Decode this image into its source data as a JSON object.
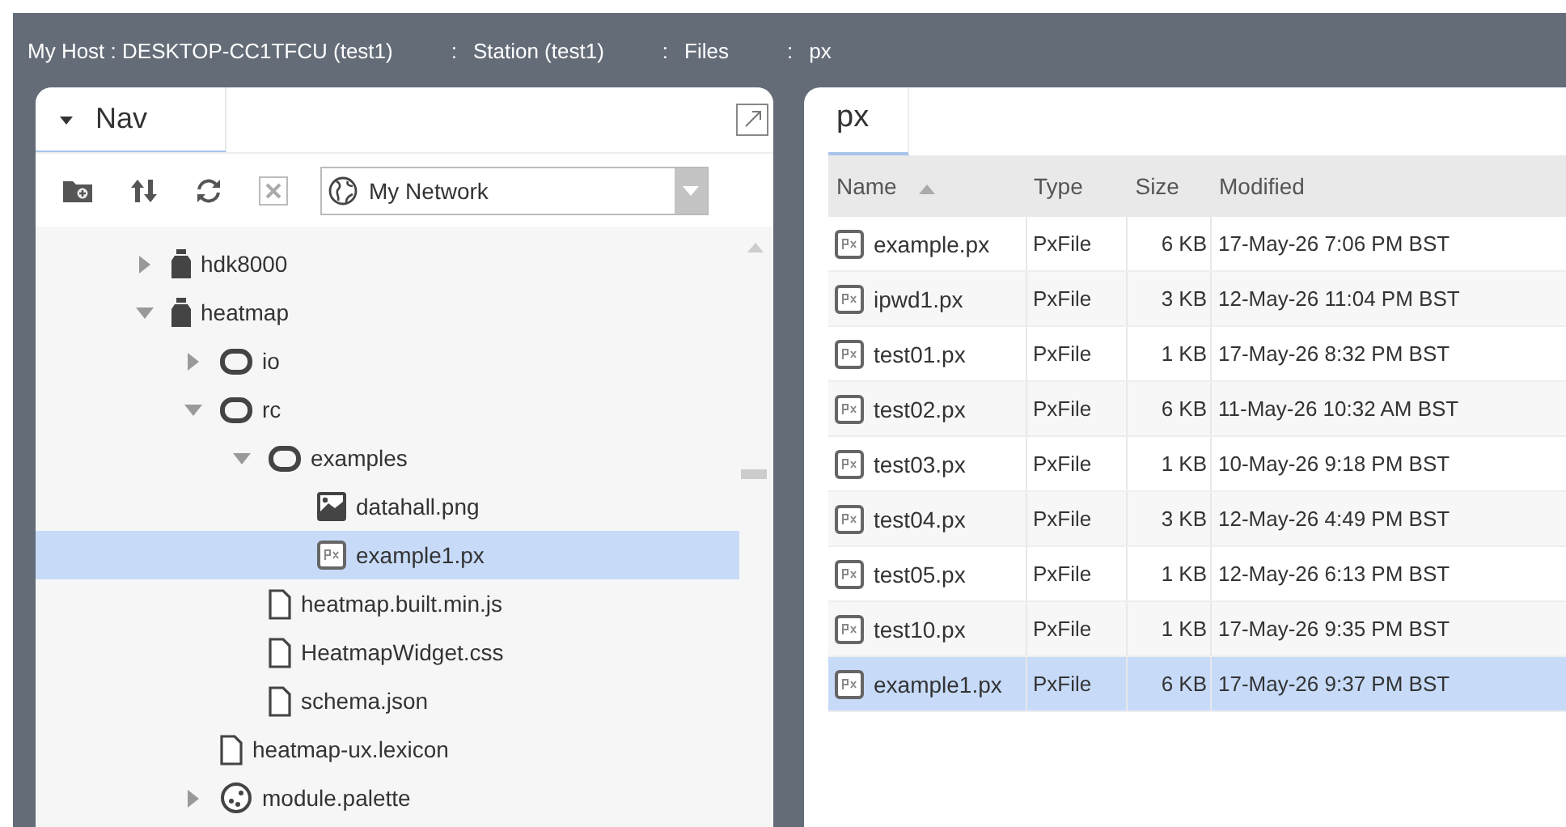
{
  "breadcrumb": {
    "separator": ":",
    "items": [
      "My Host : DESKTOP-CC1TFCU (test1)",
      "Station (test1)",
      "Files",
      "px"
    ]
  },
  "nav": {
    "tab": "Nav",
    "network": "My Network",
    "tree": [
      {
        "name": "hdk8000",
        "kind": "module",
        "expanded": false,
        "selected": false
      },
      {
        "name": "heatmap",
        "kind": "module",
        "expanded": true,
        "selected": false,
        "children": [
          {
            "name": "io",
            "kind": "folder",
            "expanded": false,
            "selected": false
          },
          {
            "name": "rc",
            "kind": "folder",
            "expanded": true,
            "selected": false,
            "children": [
              {
                "name": "examples",
                "kind": "folder",
                "expanded": true,
                "selected": false,
                "children": [
                  {
                    "name": "datahall.png",
                    "kind": "image",
                    "selected": false
                  },
                  {
                    "name": "example1.px",
                    "kind": "px",
                    "selected": true
                  }
                ]
              },
              {
                "name": "heatmap.built.min.js",
                "kind": "file",
                "selected": false
              },
              {
                "name": "HeatmapWidget.css",
                "kind": "file",
                "selected": false
              },
              {
                "name": "schema.json",
                "kind": "file",
                "selected": false
              }
            ]
          },
          {
            "name": "heatmap-ux.lexicon",
            "kind": "file",
            "selected": false
          },
          {
            "name": "module.palette",
            "kind": "palette",
            "expanded": false,
            "selected": false
          }
        ]
      }
    ]
  },
  "files": {
    "tab": "px",
    "columns": [
      "Name",
      "Type",
      "Size",
      "Modified"
    ],
    "rows": [
      {
        "name": "example.px",
        "type": "PxFile",
        "size": "6 KB",
        "modified": "17-May-26 7:06 PM BST",
        "selected": false
      },
      {
        "name": "ipwd1.px",
        "type": "PxFile",
        "size": "3 KB",
        "modified": "12-May-26 11:04 PM BST",
        "selected": false
      },
      {
        "name": "test01.px",
        "type": "PxFile",
        "size": "1 KB",
        "modified": "17-May-26 8:32 PM BST",
        "selected": false
      },
      {
        "name": "test02.px",
        "type": "PxFile",
        "size": "6 KB",
        "modified": "11-May-26 10:32 AM BST",
        "selected": false
      },
      {
        "name": "test03.px",
        "type": "PxFile",
        "size": "1 KB",
        "modified": "10-May-26 9:18 PM BST",
        "selected": false
      },
      {
        "name": "test04.px",
        "type": "PxFile",
        "size": "3 KB",
        "modified": "12-May-26 4:49 PM BST",
        "selected": false
      },
      {
        "name": "test05.px",
        "type": "PxFile",
        "size": "1 KB",
        "modified": "12-May-26 6:13 PM BST",
        "selected": false
      },
      {
        "name": "test10.px",
        "type": "PxFile",
        "size": "1 KB",
        "modified": "17-May-26 9:35 PM BST",
        "selected": false
      },
      {
        "name": "example1.px",
        "type": "PxFile",
        "size": "6 KB",
        "modified": "17-May-26 9:37 PM BST",
        "selected": true
      }
    ]
  }
}
